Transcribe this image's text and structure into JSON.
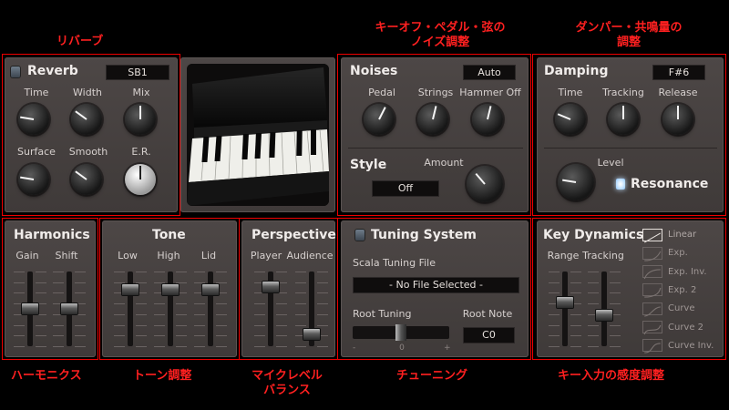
{
  "annotations": {
    "reverb": "リバーブ",
    "noises": [
      "キーオフ・ペダル・弦の",
      "ノイズ調整"
    ],
    "damping": [
      "ダンパー・共鳴量の",
      "調整"
    ],
    "harmonics": "ハーモニクス",
    "tone": "トーン調整",
    "perspective": [
      "マイクレベル",
      "バランス"
    ],
    "tuning": "チューニング",
    "key_dynamics": "キー入力の感度調整"
  },
  "reverb": {
    "title": "Reverb",
    "preset": "SB1",
    "knobs": [
      {
        "label": "Time",
        "value": 0.2
      },
      {
        "label": "Width",
        "value": 0.3
      },
      {
        "label": "Mix",
        "value": 0.5
      },
      {
        "label": "Surface",
        "value": 0.2
      },
      {
        "label": "Smooth",
        "value": 0.3
      },
      {
        "label": "E.R.",
        "value": 0.5
      }
    ]
  },
  "noises": {
    "title": "Noises",
    "mode": "Auto",
    "knobs": [
      {
        "label": "Pedal",
        "value": 0.6
      },
      {
        "label": "Strings",
        "value": 0.55
      },
      {
        "label": "Hammer Off",
        "value": 0.55
      }
    ]
  },
  "style": {
    "title": "Style",
    "value": "Off",
    "amount_label": "Amount",
    "amount_value": 0.35
  },
  "damping": {
    "title": "Damping",
    "note": "F#6",
    "knobs": [
      {
        "label": "Time",
        "value": 0.25
      },
      {
        "label": "Tracking",
        "value": 0.5
      },
      {
        "label": "Release",
        "value": 0.5
      }
    ],
    "level_label": "Level",
    "level_value": 0.2,
    "resonance_label": "Resonance"
  },
  "harmonics": {
    "title": "Harmonics",
    "sliders": [
      {
        "label": "Gain",
        "value": 0.5
      },
      {
        "label": "Shift",
        "value": 0.5
      }
    ]
  },
  "tone": {
    "title": "Tone",
    "sliders": [
      {
        "label": "Low",
        "value": 0.8
      },
      {
        "label": "High",
        "value": 0.8
      },
      {
        "label": "Lid",
        "value": 0.8
      }
    ]
  },
  "perspective": {
    "title": "Perspective",
    "sliders": [
      {
        "label": "Player",
        "value": 0.85
      },
      {
        "label": "Audience",
        "value": 0.1
      }
    ]
  },
  "tuning": {
    "title": "Tuning System",
    "scala_label": "Scala Tuning File",
    "scala_file": "- No File Selected -",
    "root_tuning_label": "Root Tuning",
    "root_tuning_value": "0",
    "root_tuning_minus": "-",
    "root_tuning_plus": "+",
    "root_note_label": "Root Note",
    "root_note_value": "C0"
  },
  "key_dynamics": {
    "title": "Key Dynamics",
    "sliders": [
      {
        "label": "Range",
        "value": 0.6
      },
      {
        "label": "Tracking",
        "value": 0.4
      }
    ],
    "curves": [
      "Linear",
      "Exp.",
      "Exp. Inv.",
      "Exp. 2",
      "Curve",
      "Curve 2",
      "Curve Inv."
    ],
    "selected_curve": "Linear"
  },
  "colors": {
    "background": "#000000",
    "panel": "#47413f",
    "annotation_red": "#ff2020",
    "display_bg": "#0f0d0d"
  }
}
